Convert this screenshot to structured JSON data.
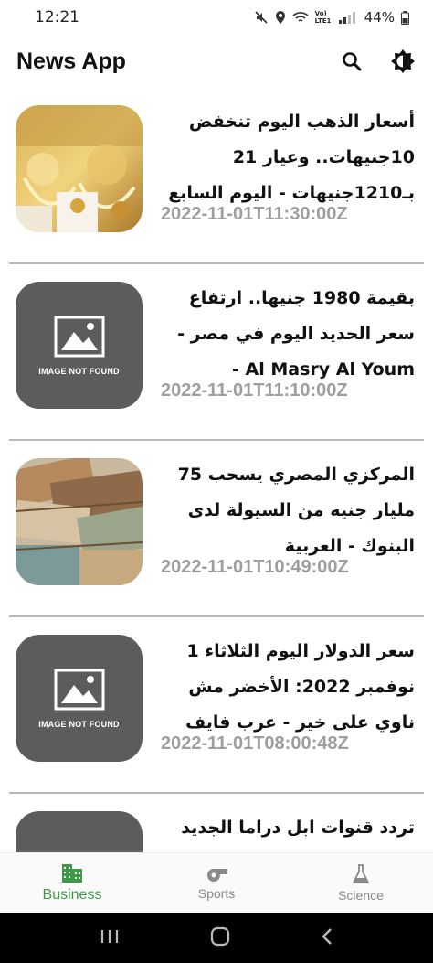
{
  "status_bar": {
    "time": "12:21",
    "battery": "44%",
    "network": "Vo) LTE1"
  },
  "app_bar": {
    "title": "News App",
    "icons": [
      "search-icon",
      "brightness-icon"
    ]
  },
  "articles": [
    {
      "headline": "أسعار الذهب اليوم تنخفض 10جنيهات.. وعيار 21 بـ1210جنيهات - اليوم السابع",
      "date": "2022-11-01T11:30:00Z",
      "has_image": true,
      "image_label": ""
    },
    {
      "headline": "بقيمة 1980 جنيها.. ارتفاع سعر الحديد اليوم في مصر - Al Masry Al Youm - المصري",
      "date": "2022-11-01T11:10:00Z",
      "has_image": false,
      "image_label": "IMAGE NOT FOUND"
    },
    {
      "headline": "المركزي المصري يسحب 75 مليار جنيه من السيولة لدى البنوك - العربية",
      "date": "2022-11-01T10:49:00Z",
      "has_image": true,
      "image_label": ""
    },
    {
      "headline": "سعر الدولار اليوم الثلاثاء 1 نوفمبر 2022: الأخضر مش ناوي على خير - عرب فايف",
      "date": "2022-11-01T08:00:48Z",
      "has_image": false,
      "image_label": "IMAGE NOT FOUND"
    },
    {
      "headline": "تردد قنوات ابل دراما الجديد",
      "date": "",
      "has_image": false,
      "image_label": ""
    }
  ],
  "bottom_nav": {
    "items": [
      {
        "label": "Business",
        "icon": "building-icon",
        "active": true
      },
      {
        "label": "Sports",
        "icon": "whistle-icon",
        "active": false
      },
      {
        "label": "Science",
        "icon": "flask-icon",
        "active": false
      }
    ]
  },
  "colors": {
    "accent": "#3f9a45",
    "date": "#9e9e9e",
    "placeholder": "#5c5c5c"
  }
}
